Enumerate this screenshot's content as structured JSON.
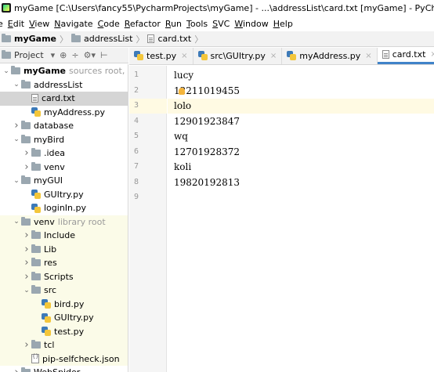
{
  "window": {
    "title": "myGame [C:\\Users\\fancy55\\PycharmProjects\\myGame] - ...\\addressList\\card.txt [myGame] - PyCharm"
  },
  "menu": [
    {
      "label": "e",
      "u": ""
    },
    {
      "label": "dit",
      "u": "E"
    },
    {
      "label": "iew",
      "u": "V"
    },
    {
      "label": "avigate",
      "u": "N"
    },
    {
      "label": "ode",
      "u": "C"
    },
    {
      "label": "efactor",
      "u": "R"
    },
    {
      "label": "un",
      "u": "R",
      "pre": "",
      "mid": true
    },
    {
      "label": "ools",
      "u": "T"
    },
    {
      "label": "VC",
      "u": "S"
    },
    {
      "label": "indow",
      "u": "W"
    },
    {
      "label": "elp",
      "u": "H"
    }
  ],
  "breadcrumb": {
    "project": "myGame",
    "folder": "addressList",
    "file": "card.txt"
  },
  "project_panel": {
    "label": "Project",
    "dropdown": "▾",
    "tools": [
      "⊕",
      "÷",
      "⚙▾",
      "⊢"
    ]
  },
  "tree": [
    {
      "indent": 0,
      "chev": "v",
      "icon": "folder",
      "label": "myGame",
      "bold": true,
      "hint": "sources root, C:\\Us"
    },
    {
      "indent": 1,
      "chev": "v",
      "icon": "folder",
      "label": "addressList"
    },
    {
      "indent": 2,
      "chev": "",
      "icon": "txt",
      "label": "card.txt",
      "selected": true
    },
    {
      "indent": 2,
      "chev": "",
      "icon": "py",
      "label": "myAddress.py"
    },
    {
      "indent": 1,
      "chev": ">",
      "icon": "folder",
      "label": "database"
    },
    {
      "indent": 1,
      "chev": "v",
      "icon": "folder",
      "label": "myBird"
    },
    {
      "indent": 2,
      "chev": ">",
      "icon": "folder",
      "label": ".idea"
    },
    {
      "indent": 2,
      "chev": ">",
      "icon": "folder",
      "label": "venv"
    },
    {
      "indent": 1,
      "chev": "v",
      "icon": "folder",
      "label": "myGUI"
    },
    {
      "indent": 2,
      "chev": "",
      "icon": "py",
      "label": "GUItry.py"
    },
    {
      "indent": 2,
      "chev": "",
      "icon": "py",
      "label": "loginIn.py"
    },
    {
      "indent": 1,
      "chev": "v",
      "icon": "folder",
      "label": "venv",
      "hint": "library root",
      "venv": true
    },
    {
      "indent": 2,
      "chev": ">",
      "icon": "folder",
      "label": "Include",
      "venv": true
    },
    {
      "indent": 2,
      "chev": ">",
      "icon": "folder",
      "label": "Lib",
      "venv": true
    },
    {
      "indent": 2,
      "chev": ">",
      "icon": "folder",
      "label": "res",
      "venv": true
    },
    {
      "indent": 2,
      "chev": ">",
      "icon": "folder",
      "label": "Scripts",
      "venv": true
    },
    {
      "indent": 2,
      "chev": "v",
      "icon": "folder",
      "label": "src",
      "venv": true
    },
    {
      "indent": 3,
      "chev": "",
      "icon": "py",
      "label": "bird.py",
      "venv": true
    },
    {
      "indent": 3,
      "chev": "",
      "icon": "py",
      "label": "GUItry.py",
      "venv": true
    },
    {
      "indent": 3,
      "chev": "",
      "icon": "py",
      "label": "test.py",
      "venv": true
    },
    {
      "indent": 2,
      "chev": ">",
      "icon": "folder",
      "label": "tcl",
      "venv": true
    },
    {
      "indent": 2,
      "chev": "",
      "icon": "json",
      "label": "pip-selfcheck.json",
      "venv": true
    },
    {
      "indent": 1,
      "chev": ">",
      "icon": "folder",
      "label": "WebSpider"
    }
  ],
  "tabs": [
    {
      "label": "test.py",
      "icon": "py"
    },
    {
      "label": "src\\GUItry.py",
      "icon": "py"
    },
    {
      "label": "myAddress.py",
      "icon": "py"
    },
    {
      "label": "card.txt",
      "icon": "txt",
      "active": true
    },
    {
      "label": "n",
      "icon": "py"
    }
  ],
  "editor": {
    "line_numbers": [
      "1",
      "2",
      "3",
      "4",
      "5",
      "6",
      "7",
      "8",
      "9"
    ],
    "lines": [
      "lucy",
      "12211019455",
      "lolo",
      "12901923847",
      "wq",
      "12701928372",
      "koli",
      "19820192813",
      ""
    ],
    "caret_line": 3
  }
}
